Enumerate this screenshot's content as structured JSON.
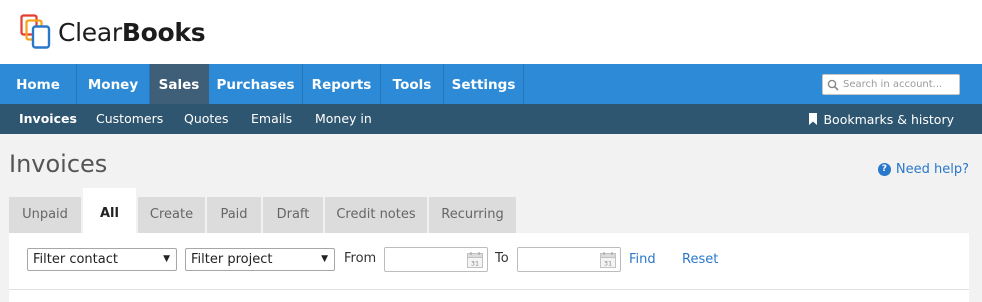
{
  "brand": {
    "logo_light": "Clear",
    "logo_bold": "Books"
  },
  "main_nav": [
    {
      "label": "Home",
      "active": false
    },
    {
      "label": "Money",
      "active": false
    },
    {
      "label": "Sales",
      "active": true
    },
    {
      "label": "Purchases",
      "active": false
    },
    {
      "label": "Reports",
      "active": false
    },
    {
      "label": "Tools",
      "active": false
    },
    {
      "label": "Settings",
      "active": false
    }
  ],
  "search": {
    "placeholder": "Search in account..."
  },
  "sub_nav": [
    {
      "label": "Invoices",
      "active": true
    },
    {
      "label": "Customers",
      "active": false
    },
    {
      "label": "Quotes",
      "active": false
    },
    {
      "label": "Emails",
      "active": false
    },
    {
      "label": "Money in",
      "active": false
    }
  ],
  "bookmarks": {
    "label": "Bookmarks & history",
    "icon": "bookmark-icon"
  },
  "page": {
    "title": "Invoices",
    "help_label": "Need help?",
    "help_icon": "question-icon"
  },
  "tabs": [
    {
      "label": "Unpaid",
      "active": false
    },
    {
      "label": "All",
      "active": true
    },
    {
      "label": "Create",
      "active": false
    },
    {
      "label": "Paid",
      "active": false
    },
    {
      "label": "Draft",
      "active": false
    },
    {
      "label": "Credit notes",
      "active": false
    },
    {
      "label": "Recurring",
      "active": false
    }
  ],
  "filters": {
    "contact_select": "Filter contact",
    "project_select": "Filter project",
    "from_label": "From",
    "to_label": "To",
    "calendar_day": "31",
    "find_label": "Find",
    "reset_label": "Reset"
  },
  "colors": {
    "nav_blue": "#2d8ad6",
    "nav_active": "#3f5f78",
    "subnav": "#2f5670",
    "link": "#2a78c9",
    "background": "#f2f2f2"
  }
}
